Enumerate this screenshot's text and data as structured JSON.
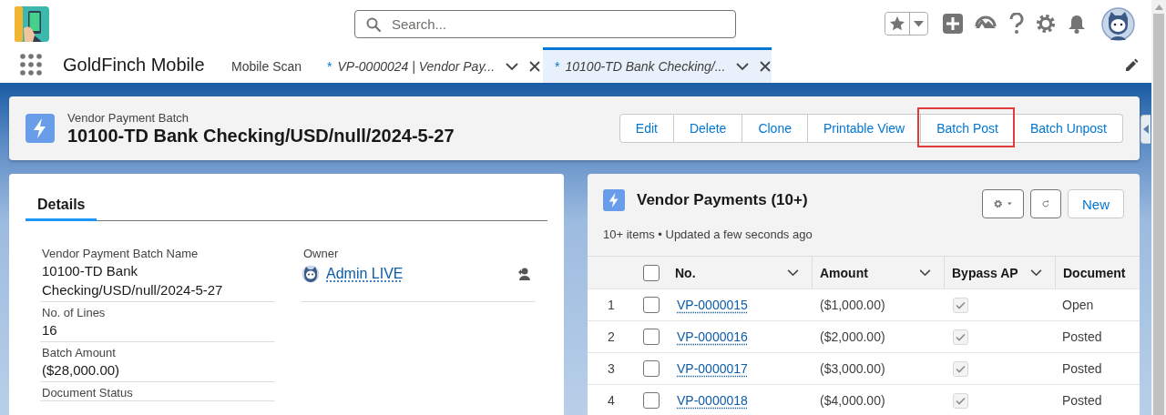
{
  "header": {
    "search": {
      "placeholder": "Search..."
    }
  },
  "nav": {
    "app_name": "GoldFinch Mobile",
    "tabs": [
      {
        "label": "Mobile Scan",
        "selected": false,
        "closable": false
      },
      {
        "marker": "*",
        "label": "VP-0000024 | Vendor Pay...",
        "selected": false,
        "closable": true
      },
      {
        "marker": "*",
        "label": "10100-TD Bank Checking/...",
        "selected": true,
        "closable": true
      }
    ]
  },
  "record": {
    "object_label": "Vendor Payment Batch",
    "title": "10100-TD Bank Checking/USD/null/2024-5-27",
    "actions": [
      {
        "label": "Edit",
        "highlighted": false
      },
      {
        "label": "Delete",
        "highlighted": false
      },
      {
        "label": "Clone",
        "highlighted": false
      },
      {
        "label": "Printable View",
        "highlighted": false
      },
      {
        "label": "Batch Post",
        "highlighted": true
      },
      {
        "label": "Batch Unpost",
        "highlighted": false
      }
    ]
  },
  "details": {
    "tabs": [
      {
        "label": "Details",
        "selected": true
      }
    ],
    "fields": [
      {
        "label": "Vendor Payment Batch Name",
        "value": "10100-TD Bank Checking/USD/null/2024-5-27"
      },
      {
        "label": "No. of Lines",
        "value": "16"
      },
      {
        "label": "Batch Amount",
        "value": "($28,000.00)"
      },
      {
        "label": "Document Status"
      }
    ],
    "owner": {
      "label": "Owner",
      "value": "Admin LIVE"
    }
  },
  "vendor_payments": {
    "title": "Vendor Payments (10+)",
    "subtitle": "10+ items • Updated a few seconds ago",
    "new_button": "New",
    "select_all": false,
    "columns": [
      "No.",
      "Amount",
      "Bypass AP",
      "Document"
    ],
    "rows": [
      {
        "index": "1",
        "selected": false,
        "number": "VP-0000015",
        "amount": "($1,000.00)",
        "bypass_ap": true,
        "document_status": "Open"
      },
      {
        "index": "2",
        "selected": false,
        "number": "VP-0000016",
        "amount": "($2,000.00)",
        "bypass_ap": true,
        "document_status": "Posted"
      },
      {
        "index": "3",
        "selected": false,
        "number": "VP-0000017",
        "amount": "($3,000.00)",
        "bypass_ap": true,
        "document_status": "Posted"
      },
      {
        "index": "4",
        "selected": false,
        "number": "VP-0000018",
        "amount": "($4,000.00)",
        "bypass_ap": true,
        "document_status": "Posted"
      }
    ]
  }
}
